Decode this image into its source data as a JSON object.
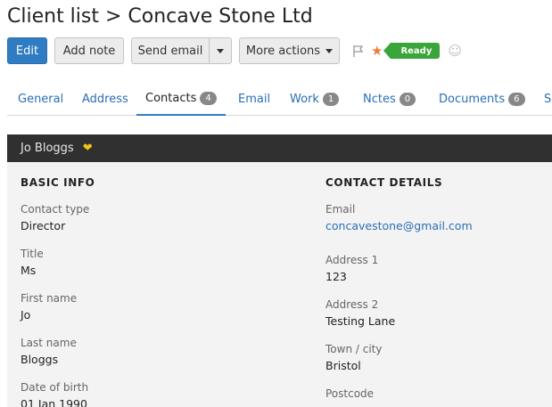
{
  "header": {
    "title": "Client list > Concave Stone Ltd"
  },
  "toolbar": {
    "edit_label": "Edit",
    "add_note_label": "Add note",
    "send_email_label": "Send email",
    "more_actions_label": "More actions",
    "status_label": "Ready",
    "status_color": "#3aa53a",
    "star_color": "#f07c3a"
  },
  "tabs": [
    {
      "label": "General"
    },
    {
      "label": "Address"
    },
    {
      "label": "Contacts",
      "count": "4"
    },
    {
      "label": "Email"
    },
    {
      "label": "Work",
      "count": "1"
    },
    {
      "label": "Nctes",
      "count": "0"
    },
    {
      "label": "Documents",
      "count": "6"
    },
    {
      "label": "S"
    }
  ],
  "contact": {
    "name": "Jo Bloggs"
  },
  "basic_info": {
    "heading": "BASIC INFO",
    "fields": [
      {
        "label": "Contact type",
        "value": "Director"
      },
      {
        "label": "Title",
        "value": "Ms"
      },
      {
        "label": "First name",
        "value": "Jo"
      },
      {
        "label": "Last name",
        "value": "Bloggs"
      },
      {
        "label": "Date of birth",
        "value": "01 Jan 1990"
      }
    ]
  },
  "contact_details": {
    "heading": "CONTACT DETAILS",
    "fields": [
      {
        "label": "Email",
        "value": "concavestone@gmail.com"
      },
      {
        "label": "Address 1",
        "value": "123"
      },
      {
        "label": "Address 2",
        "value": "Testing Lane"
      },
      {
        "label": "Town / city",
        "value": "Bristol"
      },
      {
        "label": "Postcode",
        "value": ""
      }
    ]
  }
}
